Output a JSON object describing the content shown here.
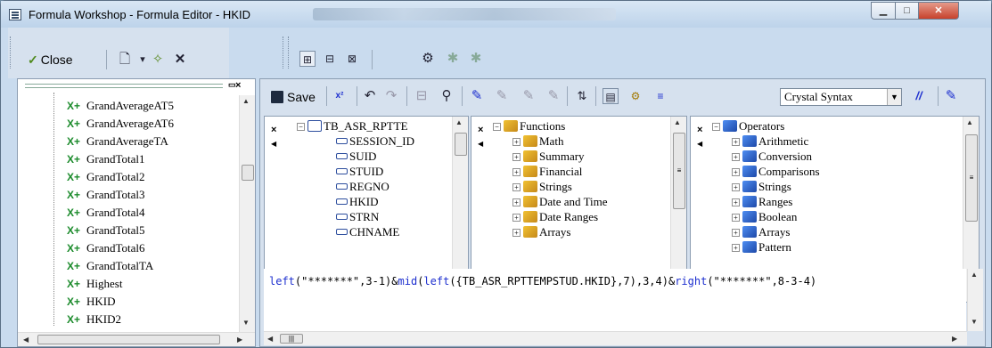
{
  "window": {
    "title": "Formula Workshop - Formula Editor - HKID",
    "min_label": "▁",
    "max_label": "□",
    "close_label": "✕"
  },
  "toolbar": {
    "close_label": "Close",
    "new_label": "🗋",
    "dropdown": "▾",
    "wand": "✧",
    "delete": "✕"
  },
  "tree": {
    "items": [
      "GrandAverageAT5",
      "GrandAverageAT6",
      "GrandAverageTA",
      "GrandTotal1",
      "GrandTotal2",
      "GrandTotal3",
      "GrandTotal4",
      "GrandTotal5",
      "GrandTotal6",
      "GrandTotalTA",
      "Highest",
      "HKID",
      "HKID2"
    ],
    "icon_text": "X+"
  },
  "editor": {
    "save_label": "Save",
    "syntax_value": "Crystal Syntax",
    "syntax_dropdown_arrow": "▼",
    "comment_label": "//",
    "formula": [
      {
        "t": "left",
        "c": "fn"
      },
      {
        "t": "(\"*******\",3-1)&",
        "c": ""
      },
      {
        "t": "mid",
        "c": "fn"
      },
      {
        "t": "(",
        "c": ""
      },
      {
        "t": "left",
        "c": "fn"
      },
      {
        "t": "({TB_ASR_RPTTEMPSTUD.HKID},7),3,4)&",
        "c": ""
      },
      {
        "t": "right",
        "c": "fn"
      },
      {
        "t": "(\"*******\",8-3-4)",
        "c": ""
      }
    ]
  },
  "fields_pane": {
    "table": "TB_ASR_RPTTE",
    "fields": [
      "SESSION_ID",
      "SUID",
      "STUID",
      "REGNO",
      "HKID",
      "STRN",
      "CHNAME"
    ]
  },
  "functions_pane": {
    "root": "Functions",
    "items": [
      "Math",
      "Summary",
      "Financial",
      "Strings",
      "Date and Time",
      "Date Ranges",
      "Arrays"
    ]
  },
  "operators_pane": {
    "root": "Operators",
    "items": [
      "Arithmetic",
      "Conversion",
      "Comparisons",
      "Strings",
      "Ranges",
      "Boolean",
      "Arrays",
      "Pattern"
    ]
  }
}
